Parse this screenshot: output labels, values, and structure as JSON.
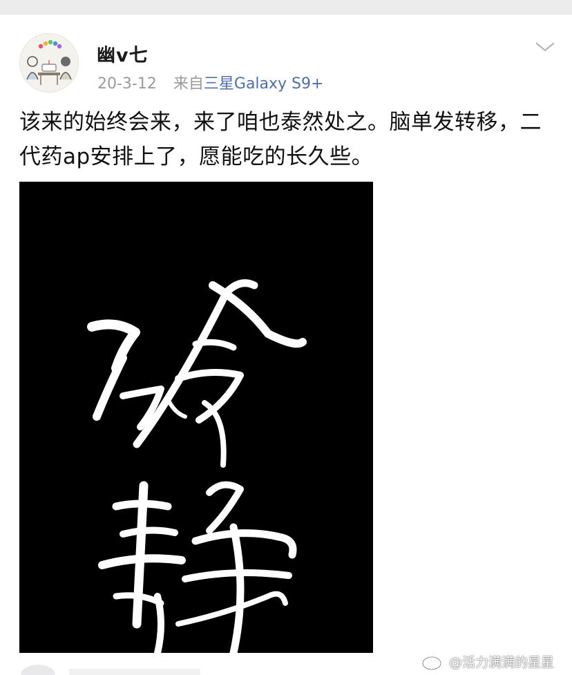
{
  "post": {
    "username": "幽v七",
    "date": "20-3-12",
    "source_prefix": "来自",
    "source_device": "三星Galaxy S9+",
    "text": "该来的始终会来，来了咱也泰然处之。脑单发转移，二代药ap安排上了，愿能吃的长久些。"
  },
  "image": {
    "calligraphy_text": "冷静"
  },
  "watermark": {
    "text": "@活力满满的星星",
    "icon": "weibo-logo-icon"
  },
  "icons": {
    "more": "chevron-down-icon",
    "avatar": "avatar"
  },
  "colors": {
    "link": "#4f6ea8",
    "meta": "#9a9a9a",
    "text": "#111111"
  }
}
